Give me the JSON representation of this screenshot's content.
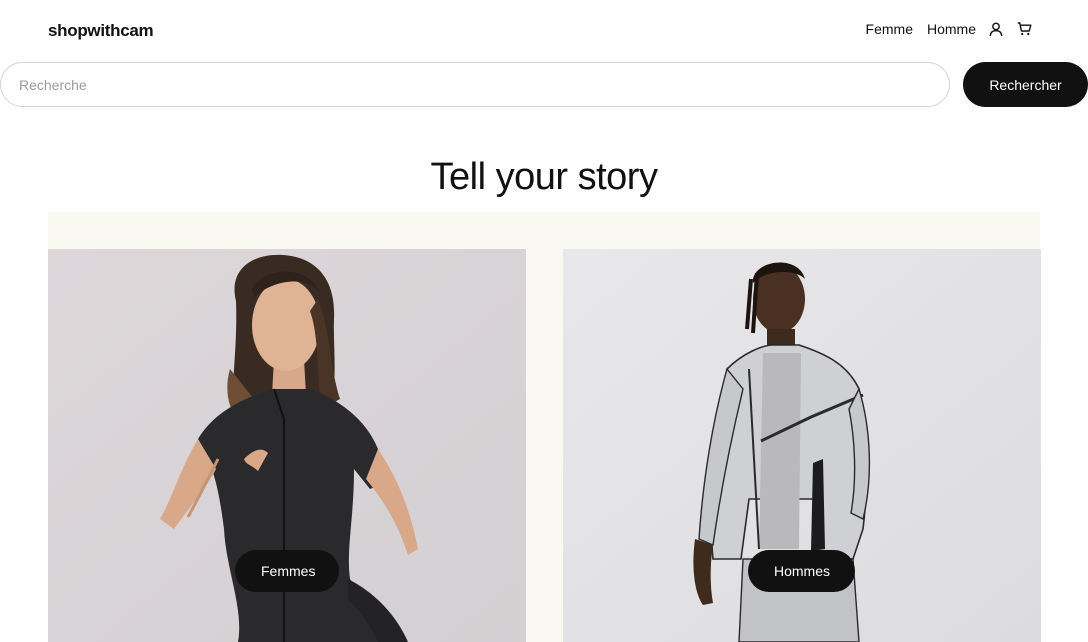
{
  "header": {
    "logo": "shopwithcam",
    "nav": [
      {
        "label": "Femme"
      },
      {
        "label": "Homme"
      }
    ],
    "icons": [
      "user-icon",
      "cart-icon"
    ]
  },
  "search": {
    "placeholder": "Recherche",
    "value": "",
    "button_label": "Rechercher"
  },
  "hero": {
    "title": "Tell your story"
  },
  "collections": [
    {
      "label": "Femmes",
      "image": "woman in black short-sleeve zip bodysuit"
    },
    {
      "label": "Hommes",
      "image": "man in reflective grey track jacket"
    }
  ],
  "colors": {
    "text": "#111111",
    "button_bg": "#111111",
    "section_bg": "#faf9f1",
    "border": "#d6d6d6"
  }
}
